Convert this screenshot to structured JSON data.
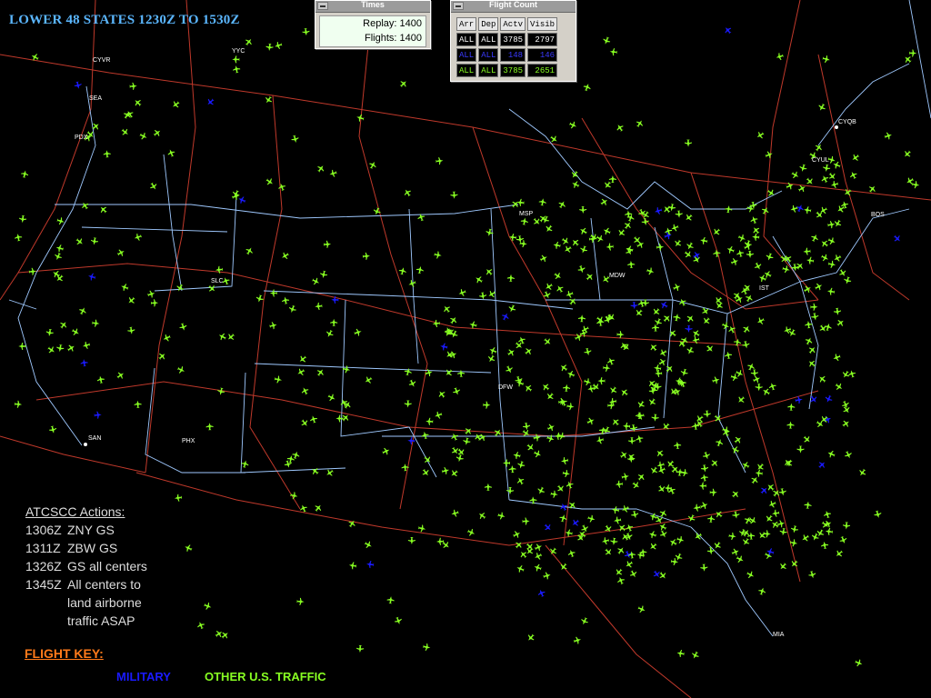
{
  "title": "LOWER 48 STATES 1230Z TO 1530Z",
  "colors": {
    "background": "#000000",
    "traffic": "#88ff22",
    "military": "#1a1aff",
    "boundaries": "#c0392b",
    "coast": "#9fc9ff",
    "key": "#ff7a1a"
  },
  "times_window": {
    "title": "Times",
    "replay_label": "Replay:",
    "replay_value": "1400",
    "flights_label": "Flights:",
    "flights_value": "1400"
  },
  "flight_count_window": {
    "title": "Flight Count",
    "headers": [
      "Arr",
      "Dep",
      "Actv",
      "Visib"
    ],
    "rows": [
      {
        "arr": "ALL",
        "dep": "ALL",
        "actv": "3785",
        "visib": "2797",
        "color": "#ffffff"
      },
      {
        "arr": "ALL",
        "dep": "ALL",
        "actv": "148",
        "visib": "146",
        "color": "#3a3aff"
      },
      {
        "arr": "ALL",
        "dep": "ALL",
        "actv": "3785",
        "visib": "2651",
        "color": "#88ff22"
      }
    ]
  },
  "map_labels": [
    "CYVR",
    "YYC",
    "SEA",
    "PDX",
    "SLC",
    "MDW",
    "CYQB",
    "CYUL",
    "BOS",
    "SAN",
    "PHX",
    "MSP",
    "IST",
    "DFW",
    "MIA"
  ],
  "actions": {
    "header": "ATCSCC Actions:",
    "items": [
      {
        "time": "1306Z",
        "text": "ZNY GS"
      },
      {
        "time": "1311Z",
        "text": "ZBW GS"
      },
      {
        "time": "1326Z",
        "text": "GS all centers"
      },
      {
        "time": "1345Z",
        "text": "All centers to"
      }
    ],
    "continuation": [
      "land airborne",
      "traffic ASAP"
    ]
  },
  "flight_key": {
    "label": "FLIGHT KEY:",
    "military": "MILITARY",
    "other": "OTHER U.S. TRAFFIC"
  }
}
